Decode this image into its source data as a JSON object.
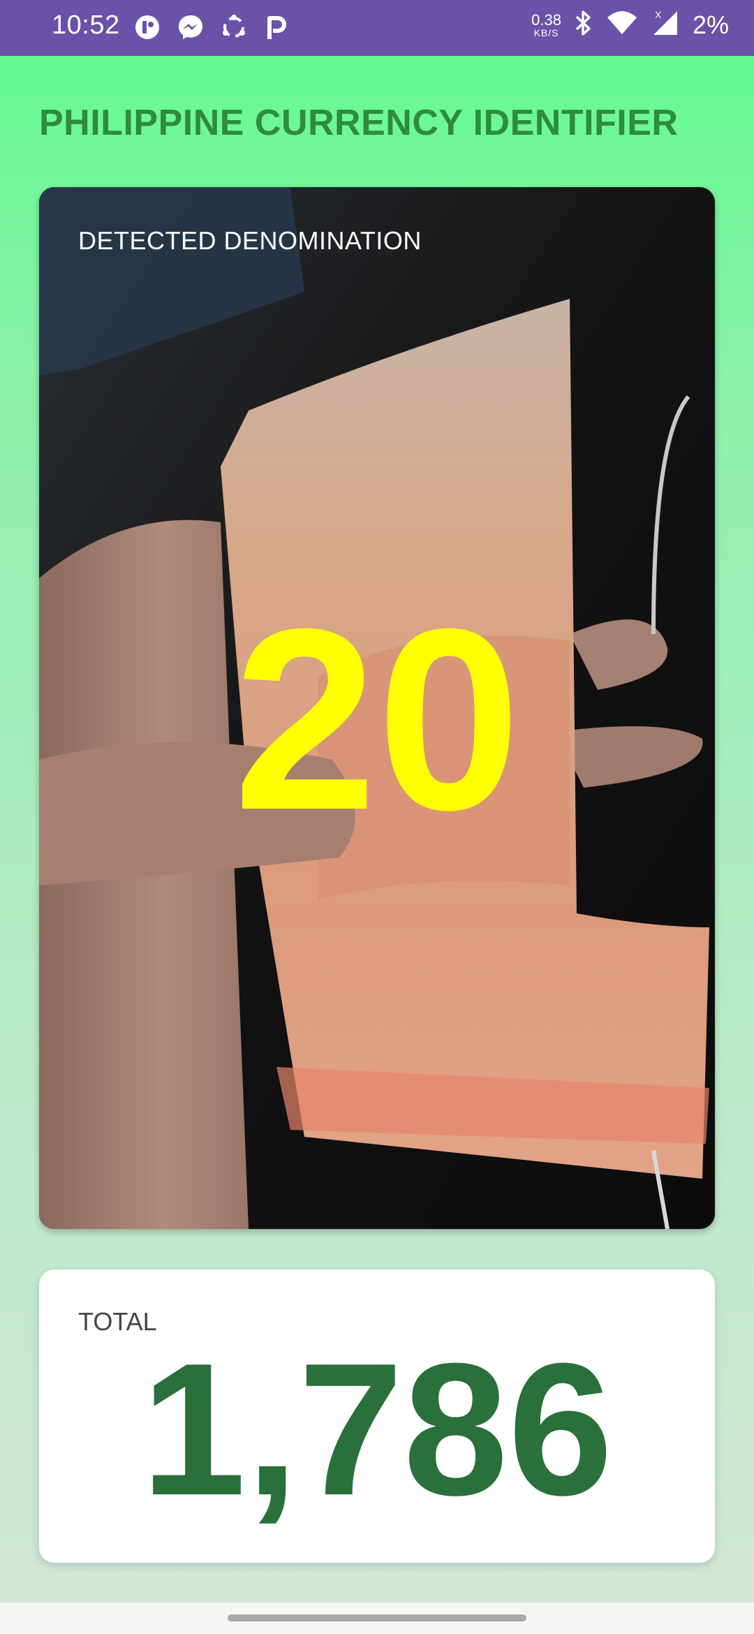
{
  "status_bar": {
    "time": "10:52",
    "net_speed_value": "0.38",
    "net_speed_unit": "KB/S",
    "battery": "2%",
    "app_icons": [
      "privacy-icon",
      "messenger-icon",
      "sync-icon",
      "p-app-icon"
    ],
    "right_icons": [
      "bluetooth-icon",
      "wifi-icon",
      "cellular-signal-icon"
    ],
    "background_color": "#6a52a8"
  },
  "app": {
    "title": "PHILIPPINE CURRENCY IDENTIFIER",
    "title_color": "#2f8c3c"
  },
  "camera": {
    "detected_label": "DETECTED DENOMINATION",
    "detected_value": "20",
    "detected_value_color": "#ffff00"
  },
  "total": {
    "label": "TOTAL",
    "value": "1,786",
    "value_color": "#29703a"
  }
}
